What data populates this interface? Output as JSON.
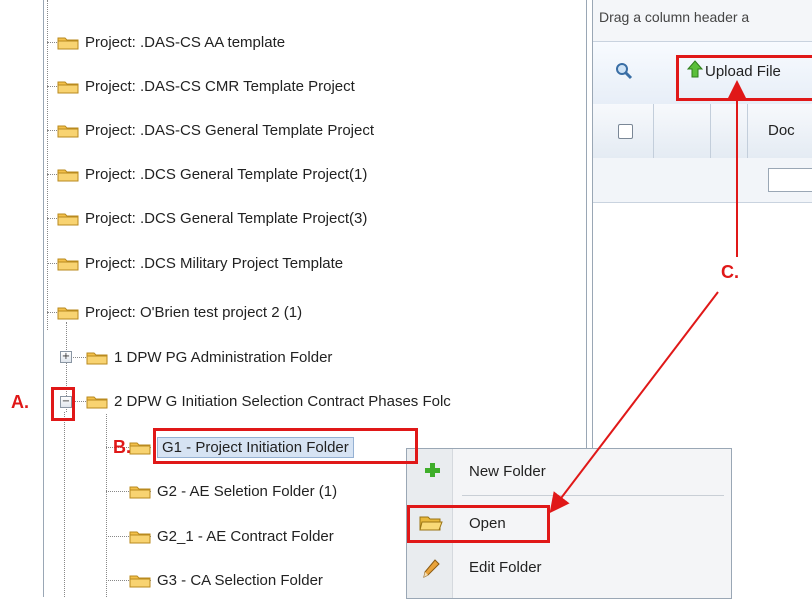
{
  "tree": {
    "items": [
      {
        "label": "Project: .DAS-CS AA template"
      },
      {
        "label": "Project: .DAS-CS CMR Template Project"
      },
      {
        "label": "Project: .DAS-CS General Template Project"
      },
      {
        "label": "Project: .DCS General Template Project(1)"
      },
      {
        "label": "Project: .DCS General Template Project(3)"
      },
      {
        "label": "Project: .DCS Military Project Template"
      },
      {
        "label": "Project: O'Brien test project 2 (1)"
      },
      {
        "label": "1 DPW PG Administration Folder"
      },
      {
        "label": "2 DPW G Initiation Selection Contract Phases Folc"
      },
      {
        "label": "G1 - Project Initiation Folder"
      },
      {
        "label": "G2 - AE Seletion Folder (1)"
      },
      {
        "label": "G2_1 - AE Contract Folder"
      },
      {
        "label": "G3 - CA Selection Folder"
      }
    ],
    "expand_symbol": "+",
    "collapse_symbol": "−"
  },
  "context_menu": {
    "new_folder": "New Folder",
    "open": "Open",
    "edit_folder": "Edit Folder"
  },
  "right_panel": {
    "group_hint": "Drag a column header a",
    "upload_label": "Upload File",
    "doc_column": "Doc"
  },
  "annotations": {
    "a": "A.",
    "b": "B.",
    "c": "C."
  },
  "colors": {
    "annotation_red": "#e01818",
    "folder_yellow": "#f3c04a",
    "selection_blue": "#d6e3f3"
  }
}
